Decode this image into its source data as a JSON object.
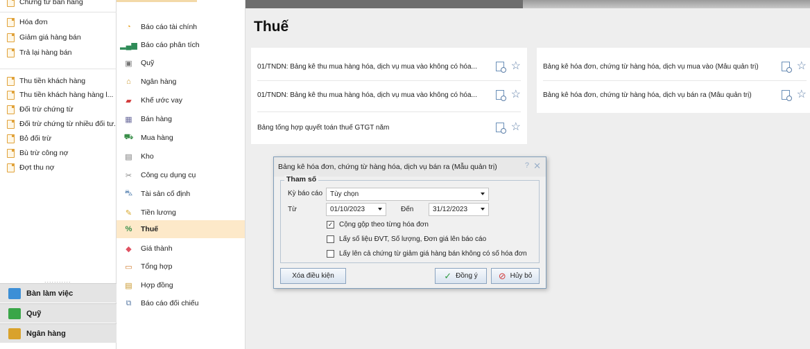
{
  "left_panel": {
    "cut_item": "Chứng từ bán hàng",
    "group1": [
      "Hóa đơn",
      "Giảm giá hàng bán",
      "Trả lại hàng bán"
    ],
    "group2": [
      "Thu tiền khách hàng",
      "Thu tiền khách hàng hàng l...",
      "Đối trừ chứng từ",
      "Đối trừ chứng từ nhiều đối tư...",
      "Bỏ đối trừ",
      "Bù trừ công nợ",
      "Đợt thu nợ"
    ],
    "dots": "...........",
    "nav": [
      "Bàn làm việc",
      "Quỹ",
      "Ngân hàng"
    ]
  },
  "menu": {
    "items": [
      {
        "label": "Báo cáo tài chính",
        "icon": "pie-chart-icon"
      },
      {
        "label": "Báo cáo phân tích",
        "icon": "bar-chart-icon"
      },
      {
        "label": "Quỹ",
        "icon": "safe-icon"
      },
      {
        "label": "Ngân hàng",
        "icon": "bank-icon"
      },
      {
        "label": "Khế ước vay",
        "icon": "loan-icon"
      },
      {
        "label": "Bán hàng",
        "icon": "sales-icon"
      },
      {
        "label": "Mua hàng",
        "icon": "cart-icon"
      },
      {
        "label": "Kho",
        "icon": "warehouse-icon"
      },
      {
        "label": "Công cụ dụng cụ",
        "icon": "tools-icon"
      },
      {
        "label": "Tài sản cố định",
        "icon": "car-icon"
      },
      {
        "label": "Tiền lương",
        "icon": "salary-icon"
      },
      {
        "label": "Thuế",
        "icon": "tax-icon"
      },
      {
        "label": "Giá thành",
        "icon": "price-tag-icon"
      },
      {
        "label": "Tổng hợp",
        "icon": "summary-icon"
      },
      {
        "label": "Hợp đồng",
        "icon": "contract-icon"
      },
      {
        "label": "Báo cáo đối chiếu",
        "icon": "compare-icon"
      }
    ],
    "active": "Thuế"
  },
  "content": {
    "title": "Thuế",
    "left_reports": [
      "01/TNDN: Bảng kê thu mua hàng hóa, dịch vụ mua vào không có hóa...",
      "01/TNDN: Bảng kê thu mua hàng hóa, dịch vụ mua vào không có hóa...",
      "Bảng tổng hợp quyết toán thuế GTGT năm"
    ],
    "right_reports": [
      "Bảng kê hóa đơn, chứng từ hàng hóa, dịch vụ mua vào (Mẫu quản trị)",
      "Bảng kê hóa đơn, chứng từ hàng hóa, dịch vụ bán ra (Mẫu quản trị)"
    ]
  },
  "dialog": {
    "title": "Bảng kê hóa đơn, chứng từ hàng hóa, dịch vụ bán ra (Mẫu quản trị)",
    "help": "?",
    "close": "✕",
    "group_label": "Tham số",
    "period_label": "Kỳ báo cáo",
    "period_value": "Tùy chọn",
    "from_label": "Từ",
    "from_value": "01/10/2023",
    "to_label": "Đến",
    "to_value": "31/12/2023",
    "checks": [
      {
        "label": "Cộng gộp theo từng hóa đơn",
        "checked": true
      },
      {
        "label": "Lấy số liệu ĐVT, Số lượng, Đơn giá lên báo cáo",
        "checked": false
      },
      {
        "label": "Lấy lên cả chứng từ giảm giá hàng bán không có số hóa đơn",
        "checked": false
      }
    ],
    "clear_button": "Xóa điều kiện",
    "ok_button": "Đồng ý",
    "cancel_button": "Hủy bỏ"
  },
  "colors": {
    "active_menu": "#fde9c9",
    "content_bg": "#eeeeee",
    "accent_blue": "#5f7fa8"
  }
}
